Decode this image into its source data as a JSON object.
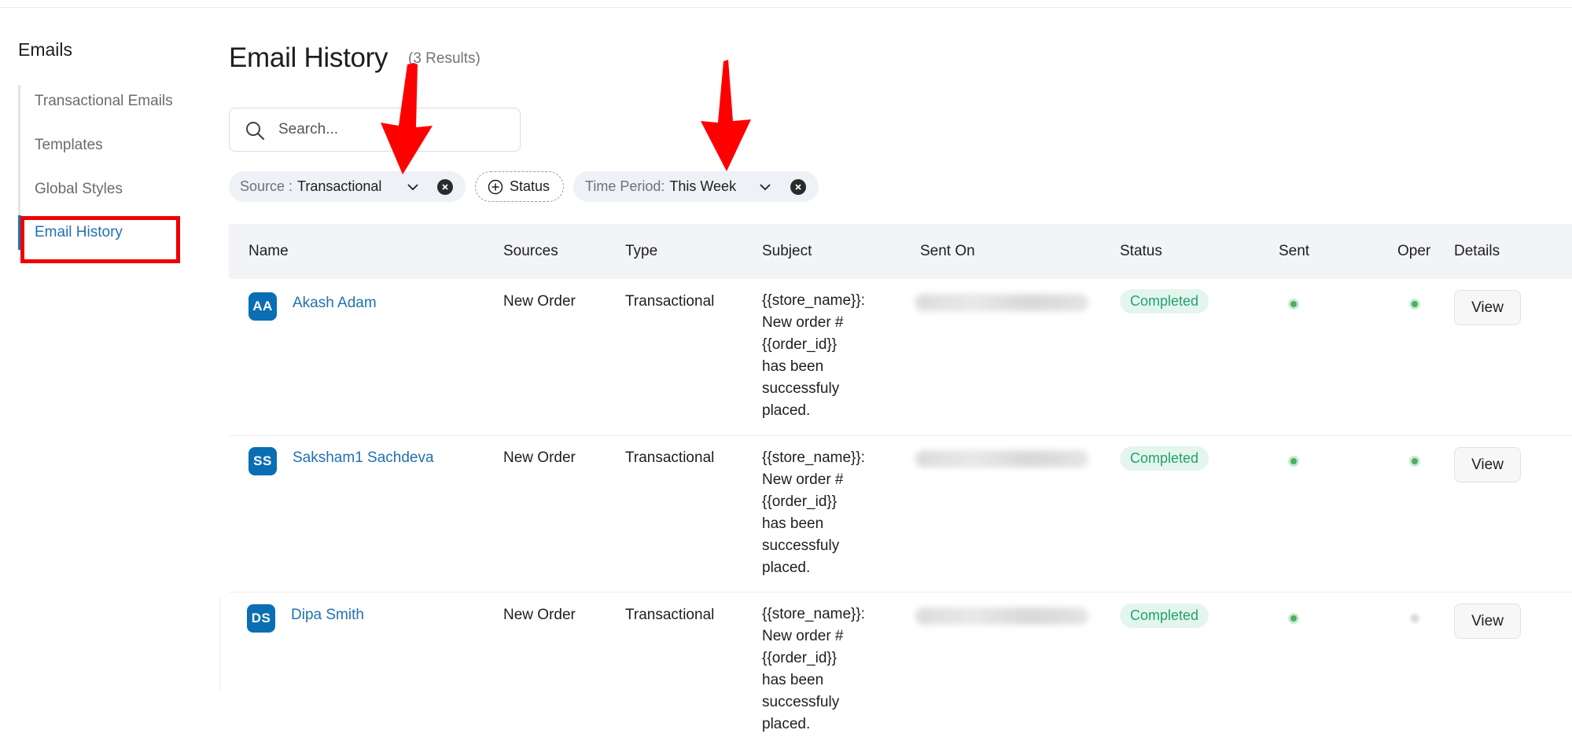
{
  "sidebar": {
    "heading": "Emails",
    "items": [
      {
        "label": "Transactional Emails"
      },
      {
        "label": "Templates"
      },
      {
        "label": "Global Styles"
      },
      {
        "label": "Email History"
      }
    ]
  },
  "header": {
    "title": "Email History",
    "result_count": "(3 Results)"
  },
  "search": {
    "placeholder": "Search..."
  },
  "filters": {
    "source_label": "Source :",
    "source_value": "Transactional",
    "status_label": "Status",
    "time_label": "Time Period:",
    "time_value": "This Week"
  },
  "table": {
    "columns": [
      "Name",
      "Sources",
      "Type",
      "Subject",
      "Sent On",
      "Status",
      "Sent",
      "Oper",
      "Details"
    ],
    "rows": [
      {
        "initials": "AA",
        "name": "Akash Adam",
        "source": "New Order",
        "type": "Transactional",
        "subject_lines": [
          "{{store_name}}:",
          "New order #",
          "{{order_id}}",
          "has been",
          "successfuly",
          "placed."
        ],
        "status": "Completed",
        "sent": "green",
        "opened": "green",
        "action": "View"
      },
      {
        "initials": "SS",
        "name": "Saksham1 Sachdeva",
        "source": "New Order",
        "type": "Transactional",
        "subject_lines": [
          "{{store_name}}:",
          "New order #",
          "{{order_id}}",
          "has been",
          "successfuly",
          "placed."
        ],
        "status": "Completed",
        "sent": "green",
        "opened": "green",
        "action": "View"
      },
      {
        "initials": "DS",
        "name": "Dipa Smith",
        "source": "New Order",
        "type": "Transactional",
        "subject_lines": [
          "{{store_name}}:",
          "New order #",
          "{{order_id}}",
          "has been",
          "successfuly",
          "placed."
        ],
        "status": "Completed",
        "sent": "green",
        "opened": "grey",
        "action": "View"
      }
    ]
  },
  "colors": {
    "accent": "#2271b1",
    "avatar": "#0a6eb3",
    "badge_bg": "#e3f5ee",
    "badge_text": "#23a26d",
    "annotation": "#ee0000"
  }
}
